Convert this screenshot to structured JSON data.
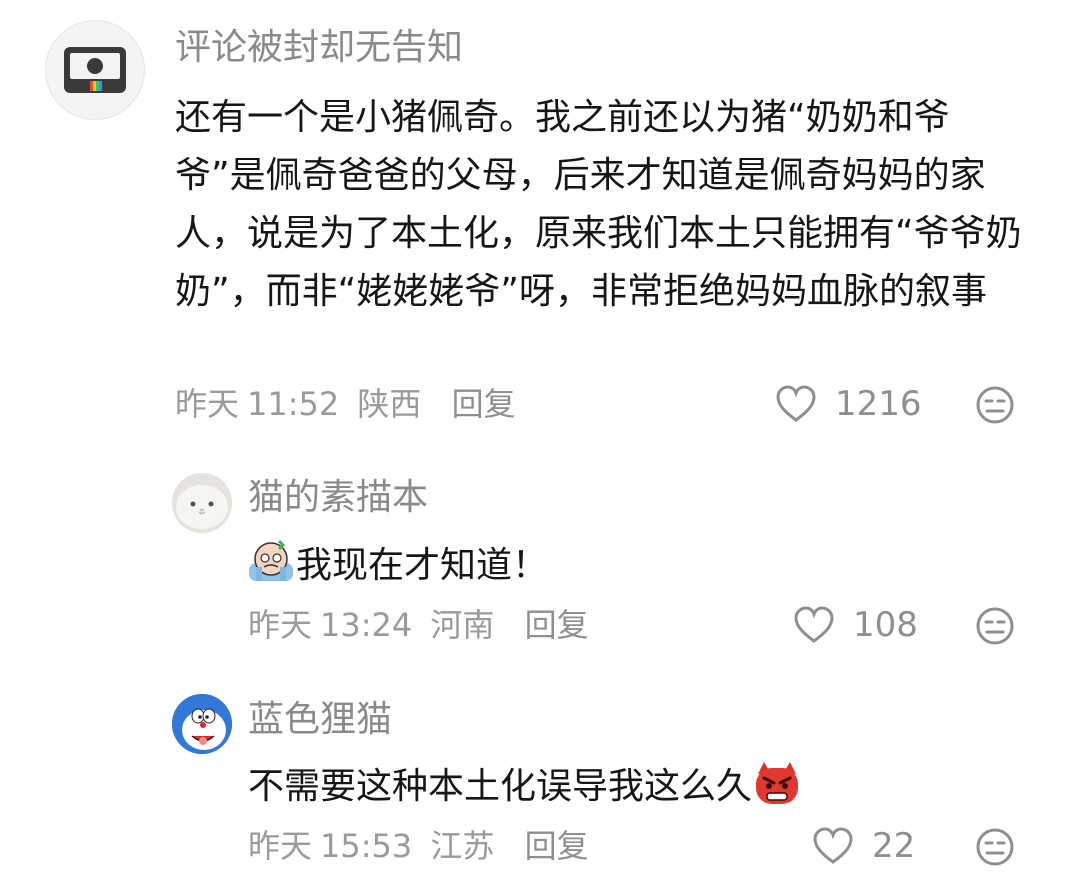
{
  "comments": [
    {
      "username": "评论被封却无告知",
      "text": "还有一个是小猪佩奇。我之前还以为猪“奶奶和爷爷”是佩奇爸爸的父母，后来才知道是佩奇妈妈的家人，说是为了本土化，原来我们本土只能拥有“爷爷奶奶”，而非“姥姥姥爷”呀，非常拒绝妈妈血脉的叙事",
      "date": "昨天",
      "time": "11:52",
      "location": "陕西",
      "reply_label": "回复",
      "likes": "1216",
      "avatar_icon": "camera-icon"
    },
    {
      "username": "猫的素描本",
      "text": "我现在才知道！",
      "leading_emoji": "crying-emoji",
      "date": "昨天",
      "time": "13:24",
      "location": "河南",
      "reply_label": "回复",
      "likes": "108",
      "avatar_icon": "white-cat-avatar"
    },
    {
      "username": "蓝色狸猫",
      "text": "不需要这种本土化误导我这么久",
      "trailing_emoji": "angry-red-face-emoji",
      "date": "昨天",
      "time": "15:53",
      "location": "江苏",
      "reply_label": "回复",
      "likes": "22",
      "avatar_icon": "doraemon-avatar"
    }
  ],
  "colors": {
    "username": "#8a8a8a",
    "text": "#161616",
    "meta": "#9a9a9a",
    "icon": "#8f8f8f"
  }
}
